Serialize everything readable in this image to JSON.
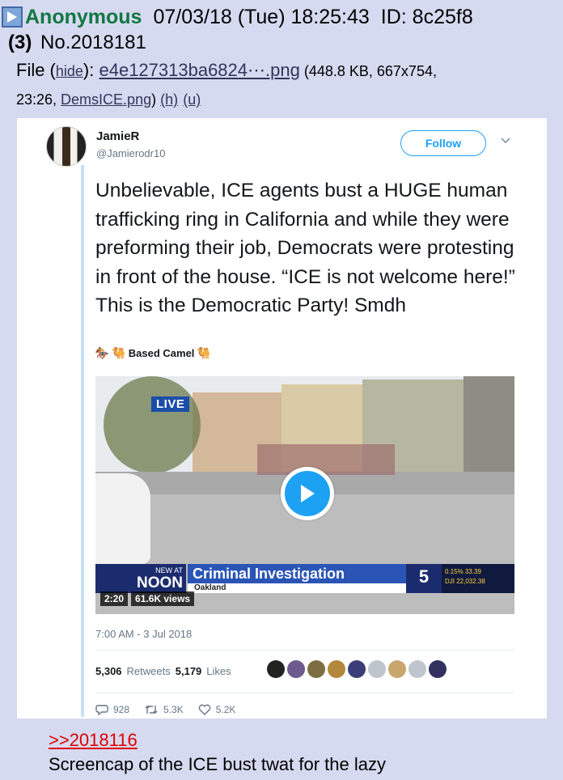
{
  "post": {
    "name": "Anonymous",
    "datetime": "07/03/18 (Tue) 18:25:43",
    "id_label": "ID: 8c25f8",
    "reply_count": "(3)",
    "post_number": "No.2018181",
    "file_prefix": "File (",
    "hide_label": "hide",
    "file_after_hide": "): ",
    "filename": "e4e127313ba6824⋯.png",
    "file_meta": " (448.8 KB, 667x754,",
    "file_meta2": "23:26, ",
    "orig_filename": "DemsICE.png",
    "file_meta3": ") ",
    "h_link": "(h)",
    "u_link": "(u)",
    "quote": ">>2018116",
    "comment": "Screencap of the ICE bust twat for the lazy"
  },
  "tweet": {
    "display_name": "JamieR",
    "handle": "@Jamierodr10",
    "follow_label": "Follow",
    "text": "Unbelievable, ICE agents bust a HUGE human trafficking ring in California and while they were preforming their job, Democrats were protesting in front of the house. “ICE is not welcome here!” This is the Democratic Party! Smdh",
    "sub_emoji_left": "🏇 🐫",
    "sub_label": "Based Camel",
    "sub_emoji_right": "🐫",
    "video": {
      "live": "LIVE",
      "new_at": "NEW AT",
      "noon": "NOON",
      "headline": "Criminal Investigation",
      "location": "Oakland",
      "station": "5",
      "ticker1": "0.15%  33.39",
      "ticker2": "DJI  22,032.38",
      "duration": "2:20",
      "views": "61.6K views"
    },
    "timestamp": "7:00 AM - 3 Jul 2018",
    "retweets_count": "5,306",
    "retweets_label": "Retweets",
    "likes_count": "5,179",
    "likes_label": "Likes",
    "replies": "928",
    "retweet_action": "5.3K",
    "like_action": "5.2K"
  },
  "colors": {
    "background": "#d6daf0",
    "name": "#117743",
    "link": "#34345c",
    "quote": "#dd0000",
    "twitter_blue": "#1da1f2"
  }
}
